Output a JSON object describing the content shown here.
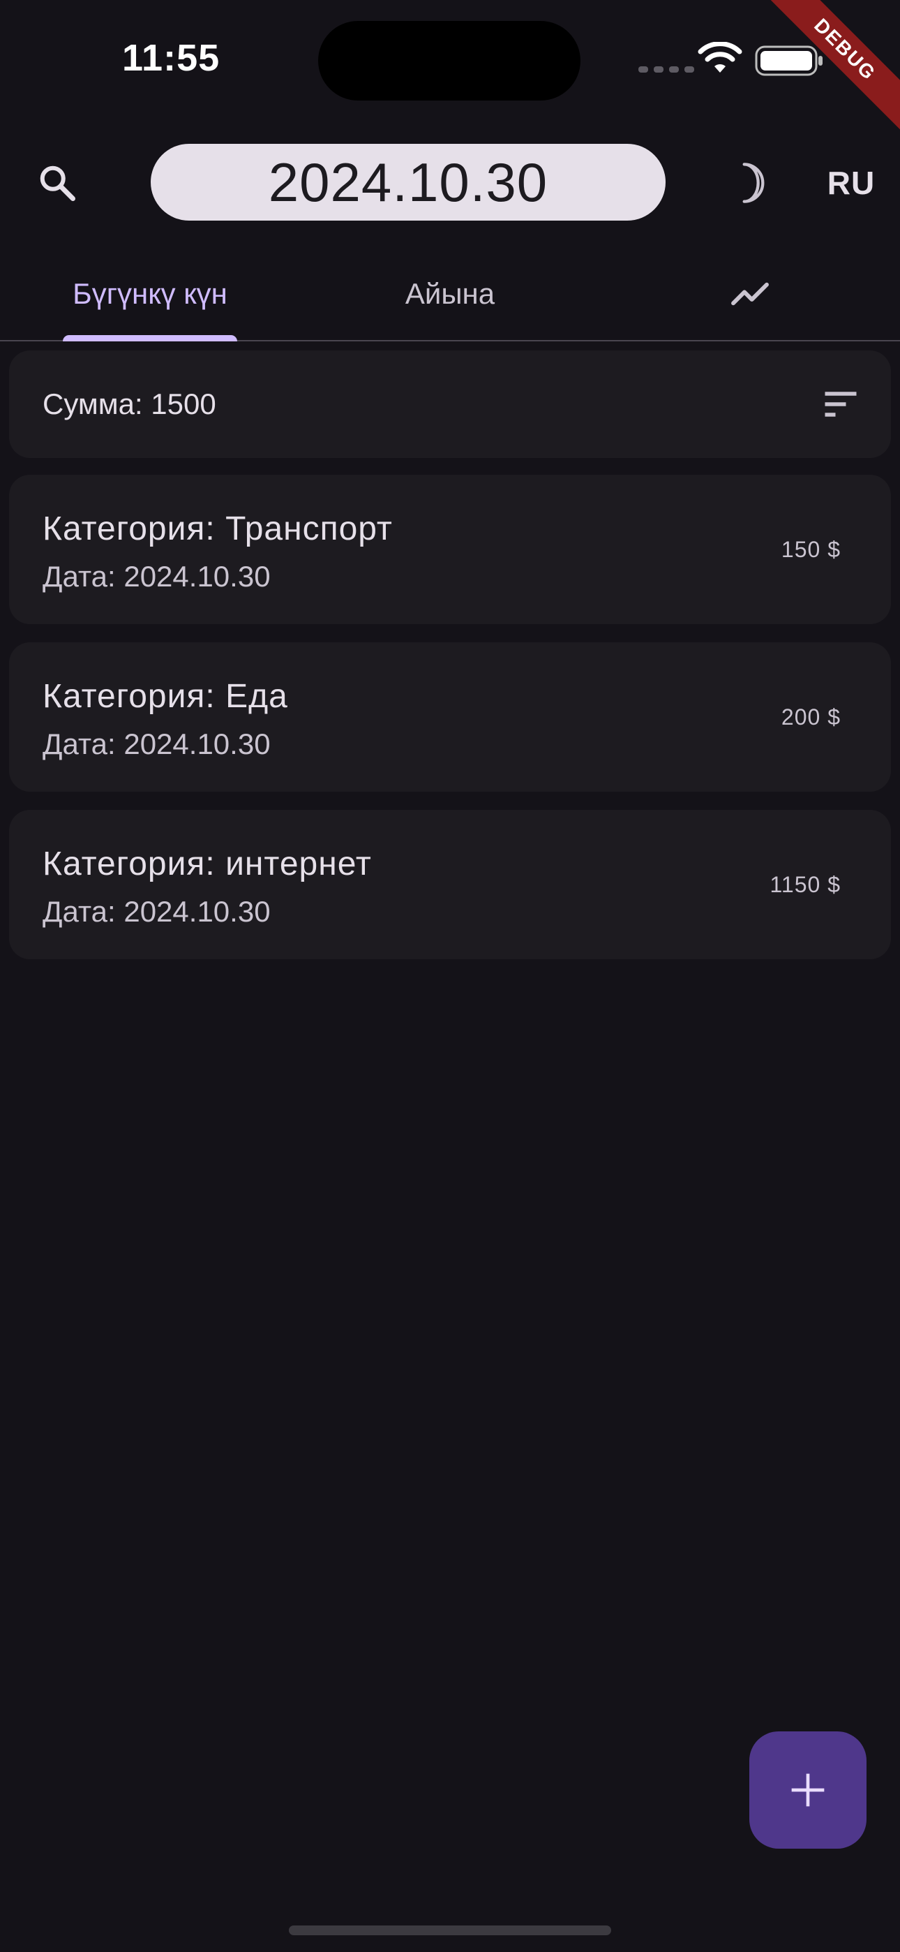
{
  "status_bar": {
    "time": "11:55"
  },
  "debug_banner": "DEBUG",
  "app_bar": {
    "search_icon": "search-icon",
    "date": "2024.10.30",
    "theme_icon": "crescent-moon-icon",
    "language": "RU"
  },
  "tabs": [
    {
      "label": "Бүгүнкү күн",
      "selected": true
    },
    {
      "label": "Айына",
      "selected": false
    },
    {
      "icon": "trending-chart-icon",
      "selected": false
    }
  ],
  "summary": {
    "text": "Сумма: 1500",
    "sort_icon": "sort-icon"
  },
  "expenses": [
    {
      "category": "Категория: Транспорт",
      "date": "Дата: 2024.10.30",
      "amount": "150 $"
    },
    {
      "category": "Категория: Еда",
      "date": "Дата: 2024.10.30",
      "amount": "200 $"
    },
    {
      "category": "Категория: интернет",
      "date": "Дата: 2024.10.30",
      "amount": "1150 $"
    }
  ],
  "fab": {
    "icon": "add-icon"
  },
  "colors": {
    "background": "#141218",
    "surface": "#1D1B20",
    "primary": "#D0BCFF",
    "fab": "#4F378B",
    "date_pill": "#E6E0E9",
    "debug_ribbon": "#8A1C1C"
  }
}
